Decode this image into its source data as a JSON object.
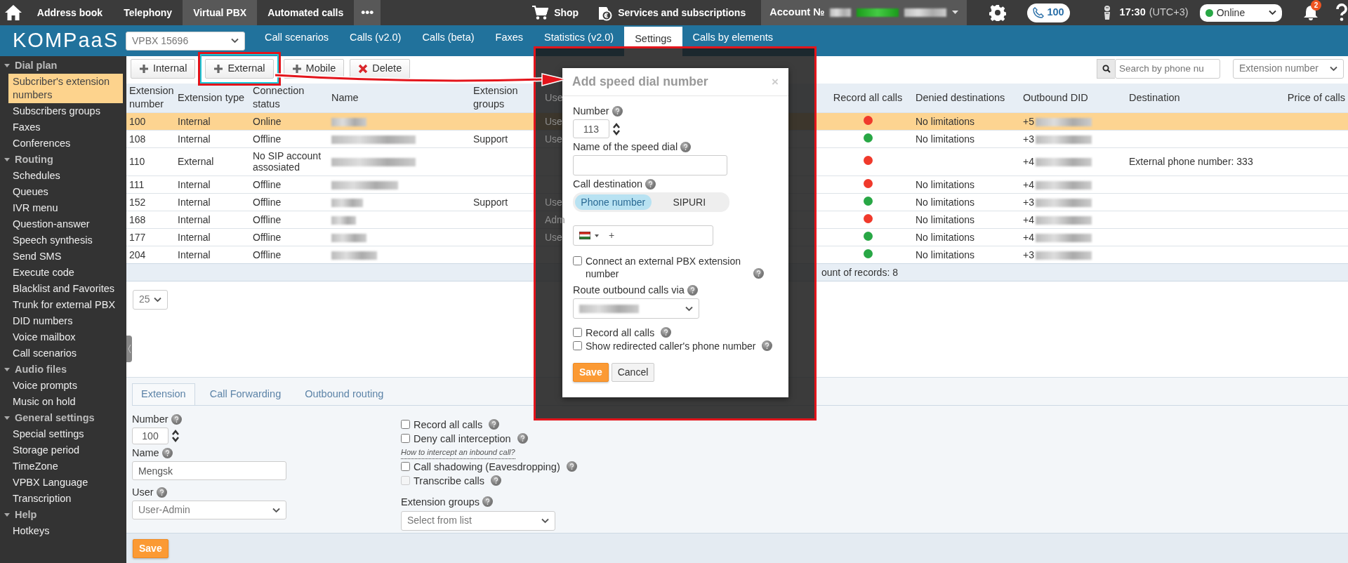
{
  "top_nav": {
    "items": [
      {
        "label": "Address book",
        "selected": false
      },
      {
        "label": "Telephony",
        "selected": false
      },
      {
        "label": "Virtual PBX",
        "selected": true
      },
      {
        "label": "Automated calls",
        "selected": false
      }
    ],
    "more": "•••",
    "shop": "Shop",
    "services": "Services and subscriptions",
    "account": "Account №",
    "phone_counter": "100",
    "time": "17:30",
    "zone": "(UTC+3)",
    "presence": {
      "value": "Online",
      "color": "#28a745"
    },
    "notifications": "2"
  },
  "logo": "KOMPaaS",
  "vpbx_select": "VPBX 15696",
  "section_tabs": [
    {
      "label": "Call scenarios",
      "selected": false
    },
    {
      "label": "Calls (v2.0)",
      "selected": false
    },
    {
      "label": "Calls (beta)",
      "selected": false
    },
    {
      "label": "Faxes",
      "selected": false
    },
    {
      "label": "Statistics (v2.0)",
      "selected": false
    },
    {
      "label": "Settings",
      "selected": true
    },
    {
      "label": "Calls by elements",
      "selected": false
    }
  ],
  "sidebar": {
    "sections": [
      {
        "label": "Dial plan",
        "expanded": true,
        "children": [
          {
            "label": "Subcriber's extension numbers",
            "selected": true
          },
          {
            "label": "Subscribers groups",
            "selected": false
          },
          {
            "label": "Faxes",
            "selected": false
          },
          {
            "label": "Conferences",
            "selected": false
          }
        ]
      },
      {
        "label": "Routing",
        "expanded": true,
        "children": [
          {
            "label": "Schedules",
            "selected": false
          },
          {
            "label": "Queues",
            "selected": false
          },
          {
            "label": "IVR menu",
            "selected": false
          },
          {
            "label": "Question-answer",
            "selected": false
          },
          {
            "label": "Speech synthesis",
            "selected": false
          },
          {
            "label": "Send SMS",
            "selected": false
          },
          {
            "label": "Execute code",
            "selected": false
          },
          {
            "label": "Blacklist and Favorites",
            "selected": false
          },
          {
            "label": "Trunk for external PBX",
            "selected": false
          },
          {
            "label": "DID numbers",
            "selected": false
          },
          {
            "label": "Voice mailbox",
            "selected": false
          },
          {
            "label": "Call scenarios",
            "selected": false
          }
        ]
      },
      {
        "label": "Audio files",
        "expanded": true,
        "children": [
          {
            "label": "Voice prompts",
            "selected": false
          },
          {
            "label": "Music on hold",
            "selected": false
          }
        ]
      },
      {
        "label": "General settings",
        "expanded": true,
        "children": [
          {
            "label": "Special settings",
            "selected": false
          },
          {
            "label": "Storage period",
            "selected": false
          },
          {
            "label": "TimeZone",
            "selected": false
          },
          {
            "label": "VPBX Language",
            "selected": false
          },
          {
            "label": "Transcription",
            "selected": false
          }
        ]
      },
      {
        "label": "Help",
        "expanded": true,
        "children": [
          {
            "label": "Hotkeys",
            "selected": false
          }
        ]
      }
    ]
  },
  "toolbar": {
    "buttons": [
      {
        "label": "Internal",
        "kind": "add",
        "highlighted": false
      },
      {
        "label": "External",
        "kind": "add",
        "highlighted": true
      },
      {
        "label": "Mobile",
        "kind": "add",
        "highlighted": false
      },
      {
        "label": "Delete",
        "kind": "delete",
        "highlighted": false
      }
    ],
    "search": {
      "placeholder": "Search by phone nu"
    },
    "sort_select": "Extension number"
  },
  "table": {
    "columns": [
      "Extension number",
      "Extension type",
      "Connection status",
      "Name",
      "Extension groups",
      "Use",
      "Record all calls",
      "Denied destinations",
      "Outbound DID",
      "Destination",
      "Price of calls"
    ],
    "rows": [
      {
        "number": "100",
        "type": "Internal",
        "status": "Online",
        "column_6": "Use",
        "record_all_calls": false,
        "denied": "No limitations",
        "outbound_did": "+5",
        "selected": true
      },
      {
        "number": "108",
        "type": "Internal",
        "status": "Offline",
        "groups": "Support",
        "column_6": "Use",
        "record_all_calls": true,
        "denied": "No limitations",
        "outbound_did": "+3",
        "selected": false
      },
      {
        "number": "110",
        "type": "External",
        "status": "No SIP account assosiated",
        "record_all_calls": false,
        "outbound_did": "+4",
        "destination": "External phone number: 333",
        "selected": false
      },
      {
        "number": "111",
        "type": "Internal",
        "status": "Offline",
        "record_all_calls": false,
        "denied": "No limitations",
        "outbound_did": "+4",
        "selected": false
      },
      {
        "number": "152",
        "type": "Internal",
        "status": "Offline",
        "groups": "Support",
        "column_6": "Use",
        "record_all_calls": true,
        "denied": "No limitations",
        "outbound_did": "+3",
        "selected": false
      },
      {
        "number": "168",
        "type": "Internal",
        "status": "Offline",
        "column_6": "Adm",
        "record_all_calls": false,
        "denied": "No limitations",
        "outbound_did": "+4",
        "selected": false
      },
      {
        "number": "177",
        "type": "Internal",
        "status": "Offline",
        "column_6": "Use",
        "record_all_calls": true,
        "denied": "No limitations",
        "outbound_did": "+4",
        "selected": false
      },
      {
        "number": "204",
        "type": "Internal",
        "status": "Offline",
        "record_all_calls": true,
        "denied": "No limitations",
        "outbound_did": "+3",
        "selected": false
      }
    ],
    "footer": "ount of records: 8"
  },
  "page_size": "25",
  "editor": {
    "tabs": [
      {
        "label": "Extension",
        "selected": true
      },
      {
        "label": "Call Forwarding",
        "selected": false
      },
      {
        "label": "Outbound routing",
        "selected": false
      }
    ],
    "number_label": "Number",
    "number": "100",
    "name_label": "Name",
    "name": "Mengsk",
    "user_label": "User",
    "user": "User-Admin",
    "checks": [
      {
        "label": "Record all calls",
        "checked": false,
        "disabled": false
      },
      {
        "label": "Deny call interception",
        "checked": false,
        "disabled": false,
        "link": "How to intercept an inbound call?"
      },
      {
        "label": "Call shadowing (Eavesdropping)",
        "checked": false,
        "disabled": false
      },
      {
        "label": "Transcribe calls",
        "checked": false,
        "disabled": true
      }
    ],
    "groups_label": "Extension groups",
    "groups_placeholder": "Select from list",
    "save": "Save"
  },
  "modal": {
    "title": "Add speed dial number",
    "close": "×",
    "number_label": "Number",
    "number": "113",
    "name_label": "Name of the speed dial",
    "destination_label": "Call destination",
    "destination_options": [
      {
        "label": "Phone number",
        "selected": true
      },
      {
        "label": "SIPURI",
        "selected": false
      }
    ],
    "phone_prefix": "+",
    "checks": [
      {
        "label": "Connect an external PBX extension number",
        "checked": false
      }
    ],
    "route_label": "Route outbound calls via",
    "checks_2": [
      {
        "label": "Record all calls",
        "checked": false
      },
      {
        "label": "Show redirected caller's phone number",
        "checked": false
      }
    ],
    "buttons": [
      {
        "label": "Save",
        "kind": "primary"
      },
      {
        "label": "Cancel",
        "kind": "secondary"
      }
    ]
  }
}
